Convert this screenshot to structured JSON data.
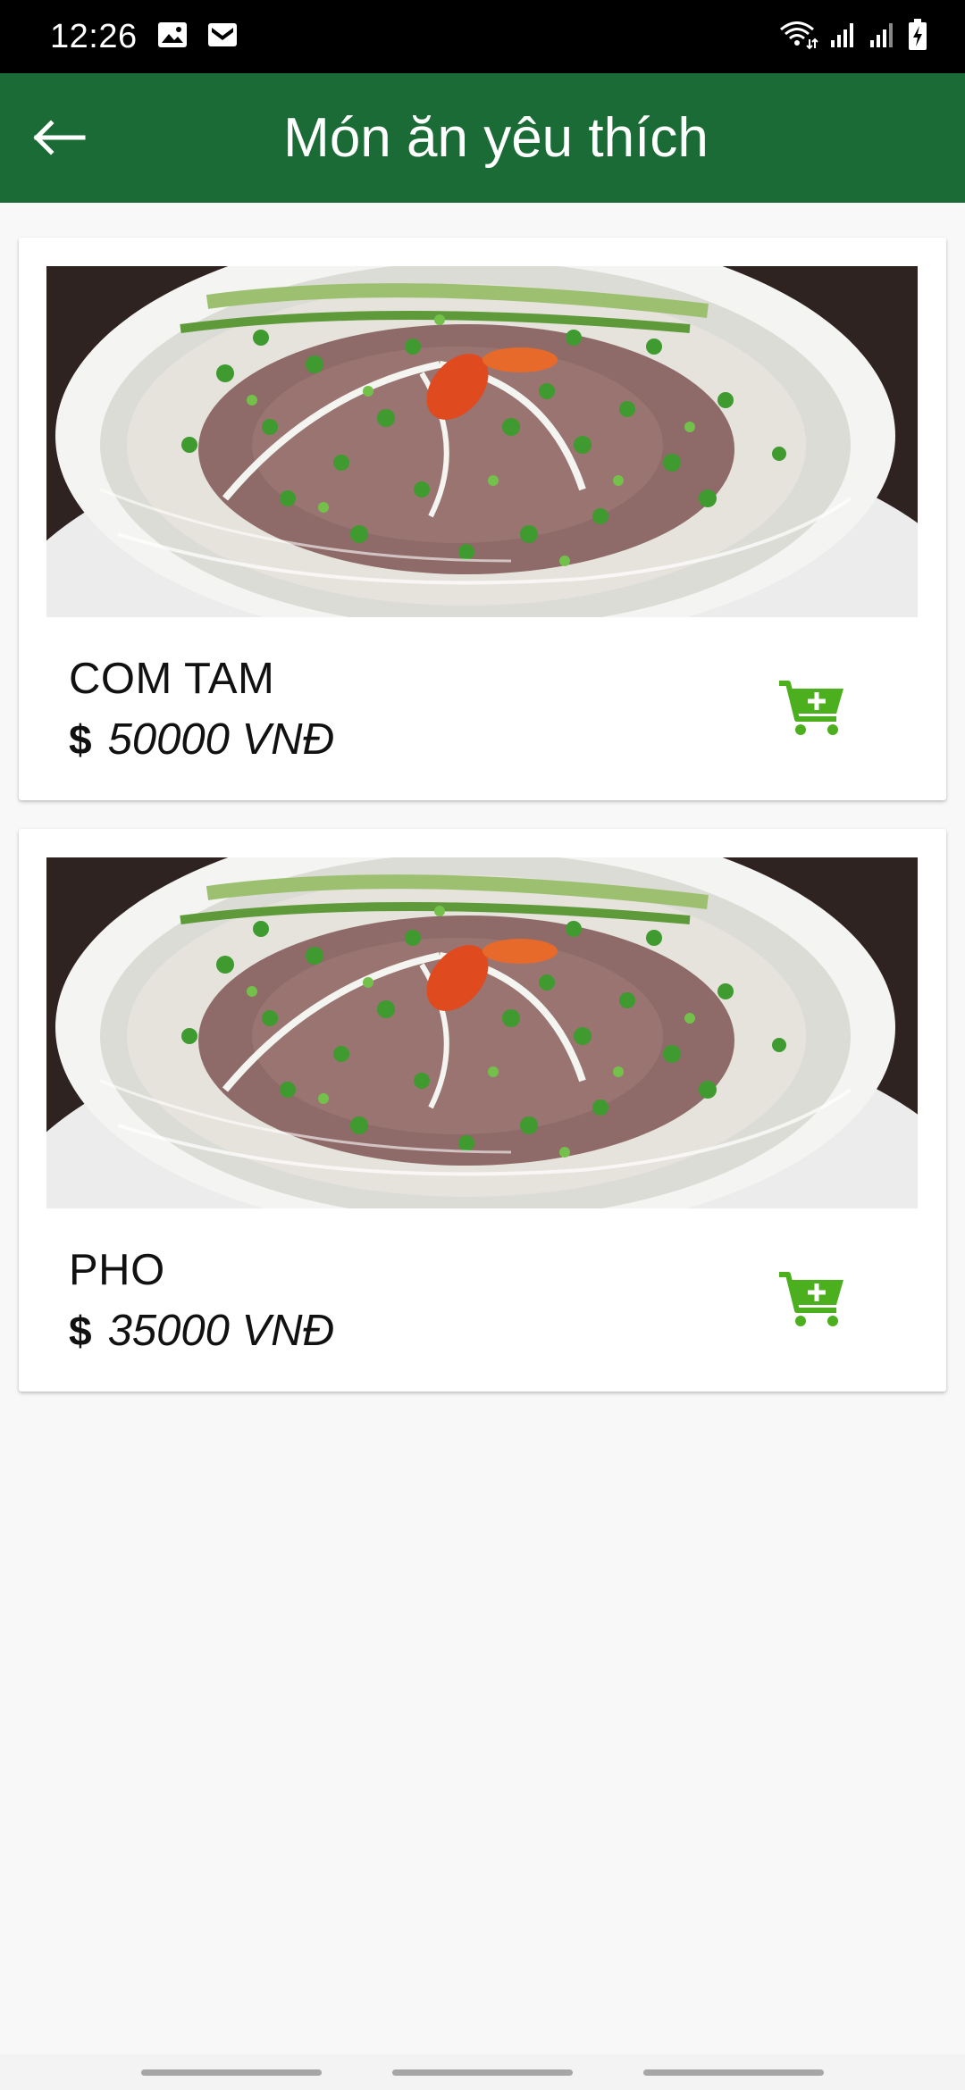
{
  "status_bar": {
    "time": "12:26",
    "left_icons": [
      "image-icon",
      "gmail-icon"
    ],
    "right_icons": [
      "wifi-icon",
      "signal-icon",
      "signal-icon",
      "battery-charging-icon"
    ]
  },
  "app_bar": {
    "title": "Món ăn yêu thích",
    "back_icon": "arrow-left-icon",
    "color": "#1a6b35"
  },
  "favorites": [
    {
      "name": "COM TAM",
      "price_symbol": "$",
      "price": "50000 VNĐ",
      "image": "pho-bowl-photo",
      "action_icon": "add-to-cart-icon"
    },
    {
      "name": "PHO",
      "price_symbol": "$",
      "price": "35000 VNĐ",
      "image": "pho-bowl-photo",
      "action_icon": "add-to-cart-icon"
    }
  ],
  "accent_colors": {
    "cart": "#4caf1e",
    "background": "#f8f8f8"
  }
}
